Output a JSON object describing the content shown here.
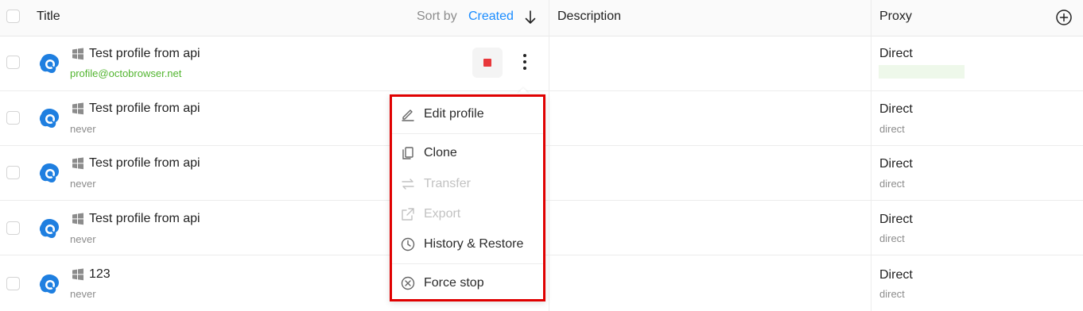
{
  "header": {
    "title": "Title",
    "sort_by_label": "Sort by",
    "sort_field": "Created",
    "description": "Description",
    "proxy": "Proxy"
  },
  "rows": [
    {
      "title": "Test profile from api",
      "subtitle": "profile@octobrowser.net",
      "proxy": "Direct",
      "proxy_sub": ""
    },
    {
      "title": "Test profile from api",
      "subtitle": "never",
      "proxy": "Direct",
      "proxy_sub": "direct"
    },
    {
      "title": "Test profile from api",
      "subtitle": "never",
      "proxy": "Direct",
      "proxy_sub": "direct"
    },
    {
      "title": "Test profile from api",
      "subtitle": "never",
      "proxy": "Direct",
      "proxy_sub": "direct"
    },
    {
      "title": "123",
      "subtitle": "never",
      "proxy": "Direct",
      "proxy_sub": "direct"
    }
  ],
  "context_menu": {
    "edit": "Edit profile",
    "clone": "Clone",
    "transfer": "Transfer",
    "export": "Export",
    "history": "History & Restore",
    "force_stop": "Force stop"
  },
  "colors": {
    "accent": "#1a8cff",
    "email": "#52b52f",
    "stop": "#e8383b",
    "highlight_border": "#e00000"
  },
  "icons": [
    "windows-icon",
    "octo-browser-icon",
    "stop-icon",
    "more-vertical-icon",
    "add-column-icon",
    "sort-arrow-down-icon",
    "edit-icon",
    "clone-icon",
    "transfer-icon",
    "export-icon",
    "history-icon",
    "force-stop-icon"
  ]
}
